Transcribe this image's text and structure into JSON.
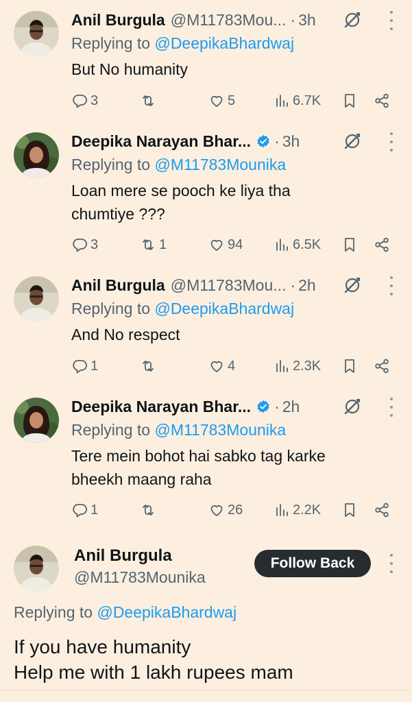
{
  "tweets": [
    {
      "name": "Anil Burgula",
      "handle": "@M11783Mou...",
      "dot": "·",
      "time": "3h",
      "replying_prefix": "Replying to",
      "replying_to": "@DeepikaBhardwaj",
      "text": "But No humanity",
      "replies": "3",
      "retweets": "",
      "likes": "5",
      "views": "6.7K",
      "verified": false
    },
    {
      "name": "Deepika Narayan Bhar...",
      "handle": "",
      "dot": "·",
      "time": "3h",
      "replying_prefix": "Replying to",
      "replying_to": "@M11783Mounika",
      "text_line1": "Loan mere se pooch ke liya tha",
      "text_line2": "chumtiye ???",
      "replies": "3",
      "retweets": "1",
      "likes": "94",
      "views": "6.5K",
      "verified": true
    },
    {
      "name": "Anil Burgula",
      "handle": "@M11783Mou...",
      "dot": "·",
      "time": "2h",
      "replying_prefix": "Replying to",
      "replying_to": "@DeepikaBhardwaj",
      "text": "And No respect",
      "replies": "1",
      "retweets": "",
      "likes": "4",
      "views": "2.3K",
      "verified": false
    },
    {
      "name": "Deepika Narayan Bhar...",
      "handle": "",
      "dot": "·",
      "time": "2h",
      "replying_prefix": "Replying to",
      "replying_to": "@M11783Mounika",
      "text_line1": "Tere mein bohot hai sabko tag karke",
      "text_line2": "bheekh maang raha",
      "replies": "1",
      "retweets": "",
      "likes": "26",
      "views": "2.2K",
      "verified": true
    }
  ],
  "main_tweet": {
    "name": "Anil Burgula",
    "handle": "@M11783Mounika",
    "follow_label": "Follow Back",
    "replying_prefix": "Replying to",
    "replying_to": "@DeepikaBhardwaj",
    "text_line1": "If you have humanity",
    "text_line2": "Help me with 1 lakh rupees mam"
  },
  "colors": {
    "background": "#fcefdf",
    "text": "#0f1419",
    "muted": "#536471",
    "link": "#1d9bf0",
    "verified": "#1d9bf0",
    "button": "#272c30"
  },
  "icons": [
    "reply-icon",
    "retweet-icon",
    "like-icon",
    "views-icon",
    "bookmark-icon",
    "share-icon",
    "grok-icon",
    "more-icon",
    "verified-icon"
  ]
}
